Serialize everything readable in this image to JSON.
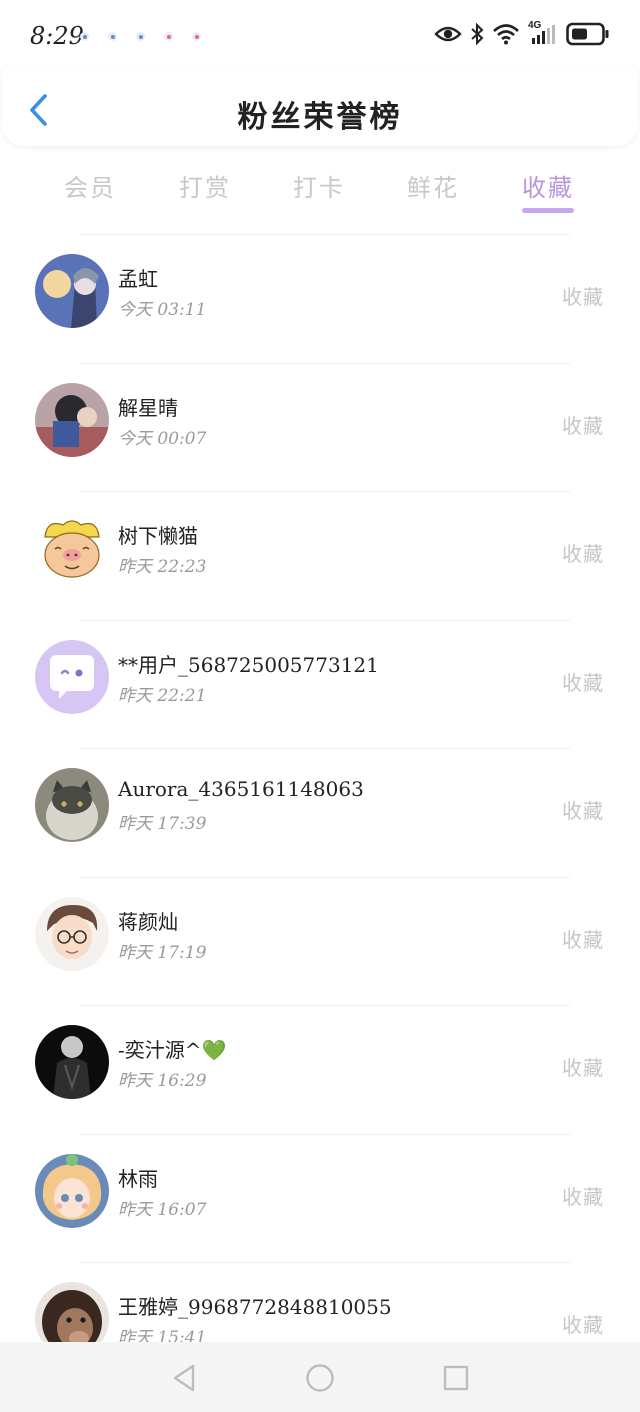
{
  "status_bar": {
    "time": "8:29",
    "network": "4G"
  },
  "header": {
    "title": "粉丝荣誉榜"
  },
  "tabs": [
    {
      "label": "会员"
    },
    {
      "label": "打赏"
    },
    {
      "label": "打卡"
    },
    {
      "label": "鲜花"
    },
    {
      "label": "收藏",
      "active": true
    }
  ],
  "fans": [
    {
      "name": "孟虹",
      "time": "今天 03:11",
      "action": "收藏"
    },
    {
      "name": "解星晴",
      "time": "今天 00:07",
      "action": "收藏"
    },
    {
      "name": "树下懒猫",
      "time": "昨天 22:23",
      "action": "收藏"
    },
    {
      "name": "**用户_568725005773121",
      "time": "昨天 22:21",
      "action": "收藏"
    },
    {
      "name": "Aurora_4365161148063",
      "time": "昨天 17:39",
      "action": "收藏"
    },
    {
      "name": "蒋颜灿",
      "time": "昨天 17:19",
      "action": "收藏"
    },
    {
      "name": "-奕汁源^💚",
      "time": "昨天 16:29",
      "action": "收藏"
    },
    {
      "name": "林雨",
      "time": "昨天 16:07",
      "action": "收藏"
    },
    {
      "name": "王雅婷_9968772848810055",
      "time": "昨天 15:41",
      "action": "收藏"
    }
  ],
  "colors": {
    "accent": "#b896dd",
    "inactive_tab": "#c8c8c8",
    "secondary_text": "#9a9a9a",
    "back_arrow": "#3a8ee6"
  },
  "icons": {
    "back": "chevron-left-icon",
    "visibility": "eye-icon",
    "bluetooth": "bluetooth-icon",
    "wifi": "wifi-icon",
    "cellular": "signal-icon",
    "battery": "battery-icon",
    "nav_back": "triangle-back-icon",
    "nav_home": "circle-home-icon",
    "nav_recent": "square-recent-icon"
  }
}
